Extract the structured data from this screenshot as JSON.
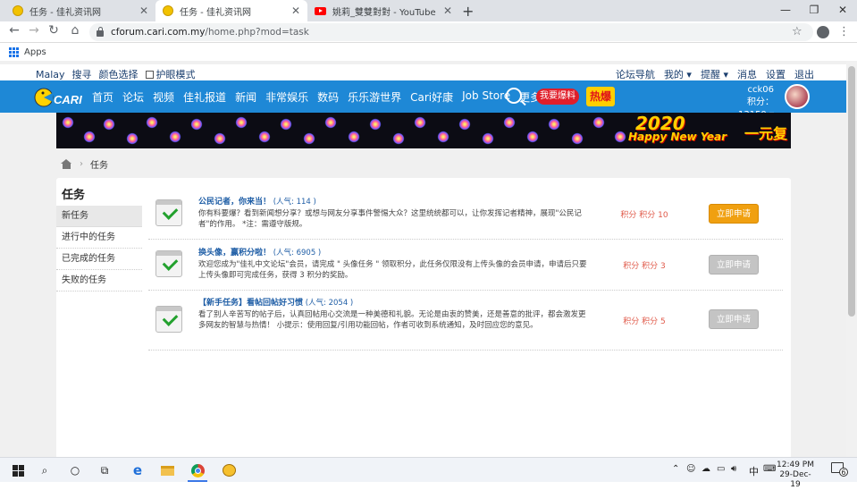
{
  "browser": {
    "tabs": [
      {
        "title": "任务 - 佳礼资讯网",
        "icon": "cari-favicon",
        "active": false
      },
      {
        "title": "任务 - 佳礼资讯网",
        "icon": "cari-favicon",
        "active": true
      },
      {
        "title": "姚莉_雙雙對對 - YouTube",
        "icon": "youtube-favicon",
        "active": false
      }
    ],
    "new_tab": "+",
    "url_host": "cforum.cari.com.my",
    "url_path": "/home.php?mod=task",
    "bookmarks": {
      "apps_label": "Apps"
    }
  },
  "site": {
    "topbar": {
      "lang": "Malay",
      "search": "搜寻",
      "color": "颜色选择",
      "eye_mode": "护眼模式",
      "nav_link": "论坛导航",
      "mine": "我的",
      "remind": "提醒",
      "msg": "消息",
      "settings": "设置",
      "logout": "退出"
    },
    "mainnav": {
      "items": [
        "首页",
        "论坛",
        "视频",
        "佳礼报道",
        "新闻",
        "非常娱乐",
        "数码",
        "乐乐游世界",
        "Cari好康",
        "Job Store",
        "更多"
      ],
      "baoliao": "我要爆料",
      "rebao": "热爆"
    },
    "user": {
      "name": "cck06",
      "points": "积分：13150"
    },
    "banner": {
      "year": "2020",
      "greeting": "Happy New Year",
      "cn_text": "一元复"
    },
    "breadcrumb": {
      "current": "任务"
    }
  },
  "panel": {
    "title": "任务",
    "side": [
      "新任务",
      "进行中的任务",
      "已完成的任务",
      "失败的任务"
    ],
    "tasks": [
      {
        "name": "公民记者，你来当！",
        "popularity": "(人气: 114 )",
        "desc": "你有料要爆？看到新闻想分享？或想与网友分享事件警惕大众？这里统统都可以，让你发挥记者精神，展现\"公民记者\"的作用。 *注：需遵守版规。",
        "reward": "积分 积分 10",
        "button": "立即申请",
        "enabled": true
      },
      {
        "name": "换头像，赢积分啦！",
        "popularity": "(人气: 6905 )",
        "desc": "欢迎您成为\"佳礼中文论坛\"会员，请完成 \" 头像任务 \" 领取积分，此任务仅限没有上传头像的会员申请，申请后只要上传头像即可完成任务，获得 3 积分的奖励。",
        "reward": "积分 积分 3",
        "button": "立即申请",
        "enabled": false
      },
      {
        "name": "【新手任务】看帖回帖好习惯",
        "popularity": "(人气: 2054 )",
        "desc": "看了别人辛苦写的帖子后，认真回帖用心交流是一种美德和礼貌。无论是由衷的赞美，还是善意的批评，都会激发更多网友的智慧与热情！ 小提示：使用回复/引用功能回帖，作者可收到系统通知，及时回应您的意见。",
        "reward": "积分 积分 5",
        "button": "立即申请",
        "enabled": false
      }
    ]
  },
  "taskbar": {
    "time": "12:49 PM",
    "date": "29-Dec-19",
    "ime": "中",
    "notif_count": "6"
  }
}
